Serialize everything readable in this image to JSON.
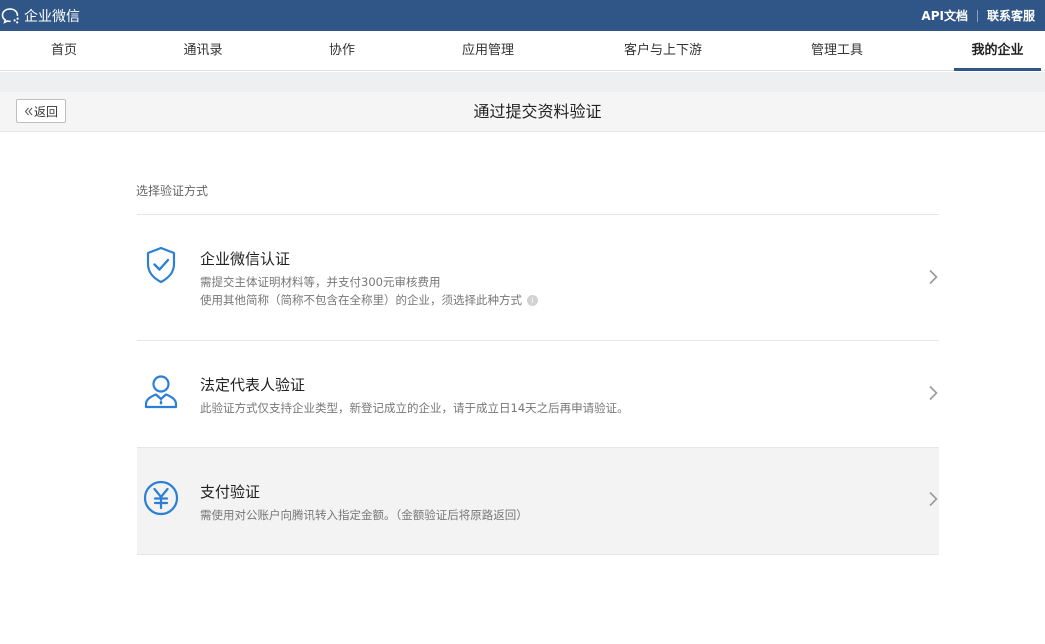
{
  "app": {
    "name": "企业微信"
  },
  "top_links": [
    "API文档",
    "联系客服"
  ],
  "nav": {
    "items": [
      "首页",
      "通讯录",
      "协作",
      "应用管理",
      "客户与上下游",
      "管理工具",
      "我的企业"
    ],
    "active": "我的企业"
  },
  "subheader": {
    "back_label": "返回",
    "title": "通过提交资料验证"
  },
  "section": {
    "label": "选择验证方式"
  },
  "options": [
    {
      "title": "企业微信认证",
      "desc": [
        "需提交主体证明材料等，并支付300元审核费用",
        "使用其他简称（简称不包含在全称里）的企业，须选择此种方式"
      ],
      "icon": "shield-check-icon"
    },
    {
      "title": "法定代表人验证",
      "desc": [
        "此验证方式仅支持企业类型，新登记成立的企业，请于成立日14天之后再申请验证。"
      ],
      "icon": "person-icon"
    },
    {
      "title": "支付验证",
      "desc": [
        "需使用对公账户向腾讯转入指定金额。（金额验证后将原路返回）"
      ],
      "icon": "yen-icon"
    }
  ],
  "colors": {
    "header_bg": "#2f5687",
    "icon_blue": "#2c7fd6",
    "hover_bg": "#f3f3f3"
  }
}
